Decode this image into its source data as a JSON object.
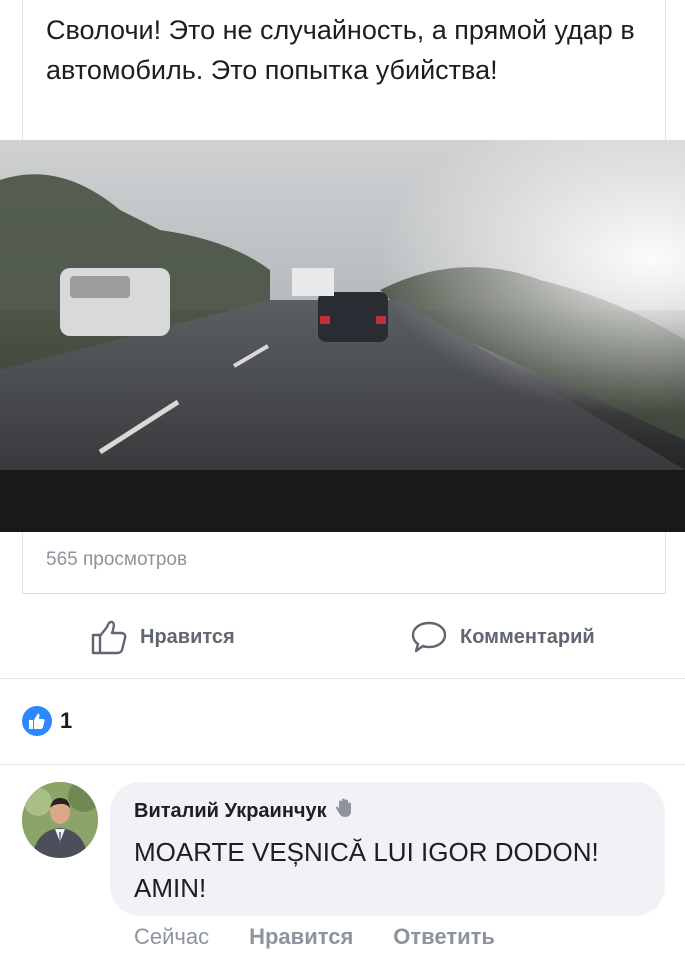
{
  "post": {
    "text": "Сволочи! Это не случайность, а прямой удар в автомобиль. Это попытка убийства!",
    "views": "565 просмотров"
  },
  "actions": {
    "like_label": "Нравится",
    "comment_label": "Комментарий"
  },
  "reactions": {
    "count": "1",
    "icon": "thumbs-up-icon",
    "color": "#2d88ff"
  },
  "comment": {
    "author": "Виталий Украинчук",
    "author_badge": "waving-hand-icon",
    "text": "MOARTE VEȘNICĂ LUI IGOR DODON! AMIN!",
    "time": "Сейчас",
    "like_label": "Нравится",
    "reply_label": "Ответить"
  }
}
